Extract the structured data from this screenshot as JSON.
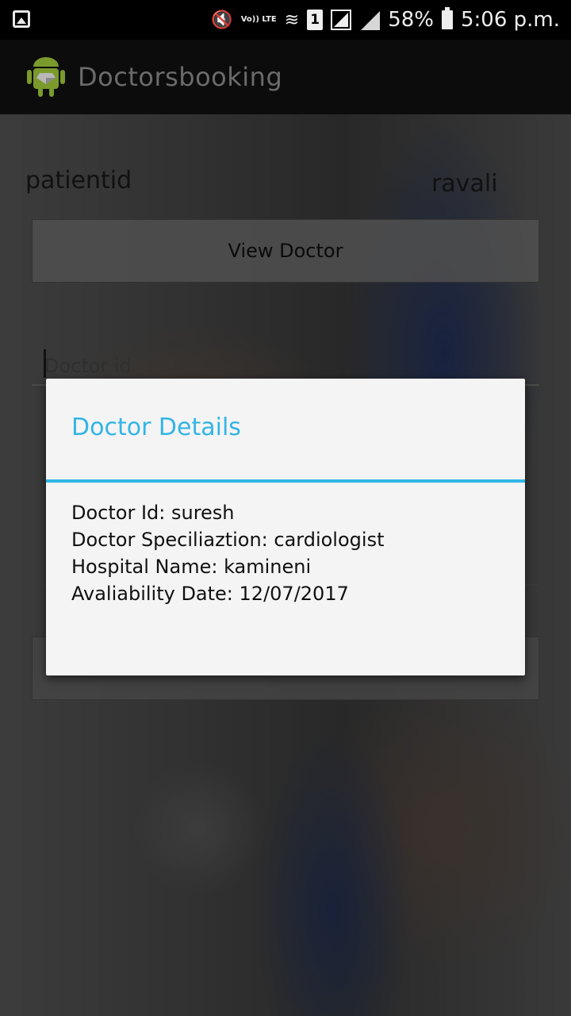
{
  "status_bar": {
    "battery_percent": "58%",
    "time": "5:06 p.m.",
    "sim_slot": "1",
    "volte": "Vo)) LTE"
  },
  "app_bar": {
    "title": "Doctorsbooking",
    "icon": "android-icon"
  },
  "form": {
    "patient_label": "patientid",
    "patient_value": "ravali",
    "view_doctor_label": "View Doctor",
    "doctor_id_placeholder": "Doctor id"
  },
  "dialog": {
    "title": "Doctor Details",
    "lines": [
      "Doctor Id: suresh",
      "Doctor Speciliaztion: cardiologist",
      "Hospital Name: kamineni",
      "Avaliability Date: 12/07/2017"
    ]
  },
  "colors": {
    "accent": "#33b5e5",
    "dialog_bg": "#f4f4f4",
    "app_bar_bg": "#0c0c0c"
  }
}
